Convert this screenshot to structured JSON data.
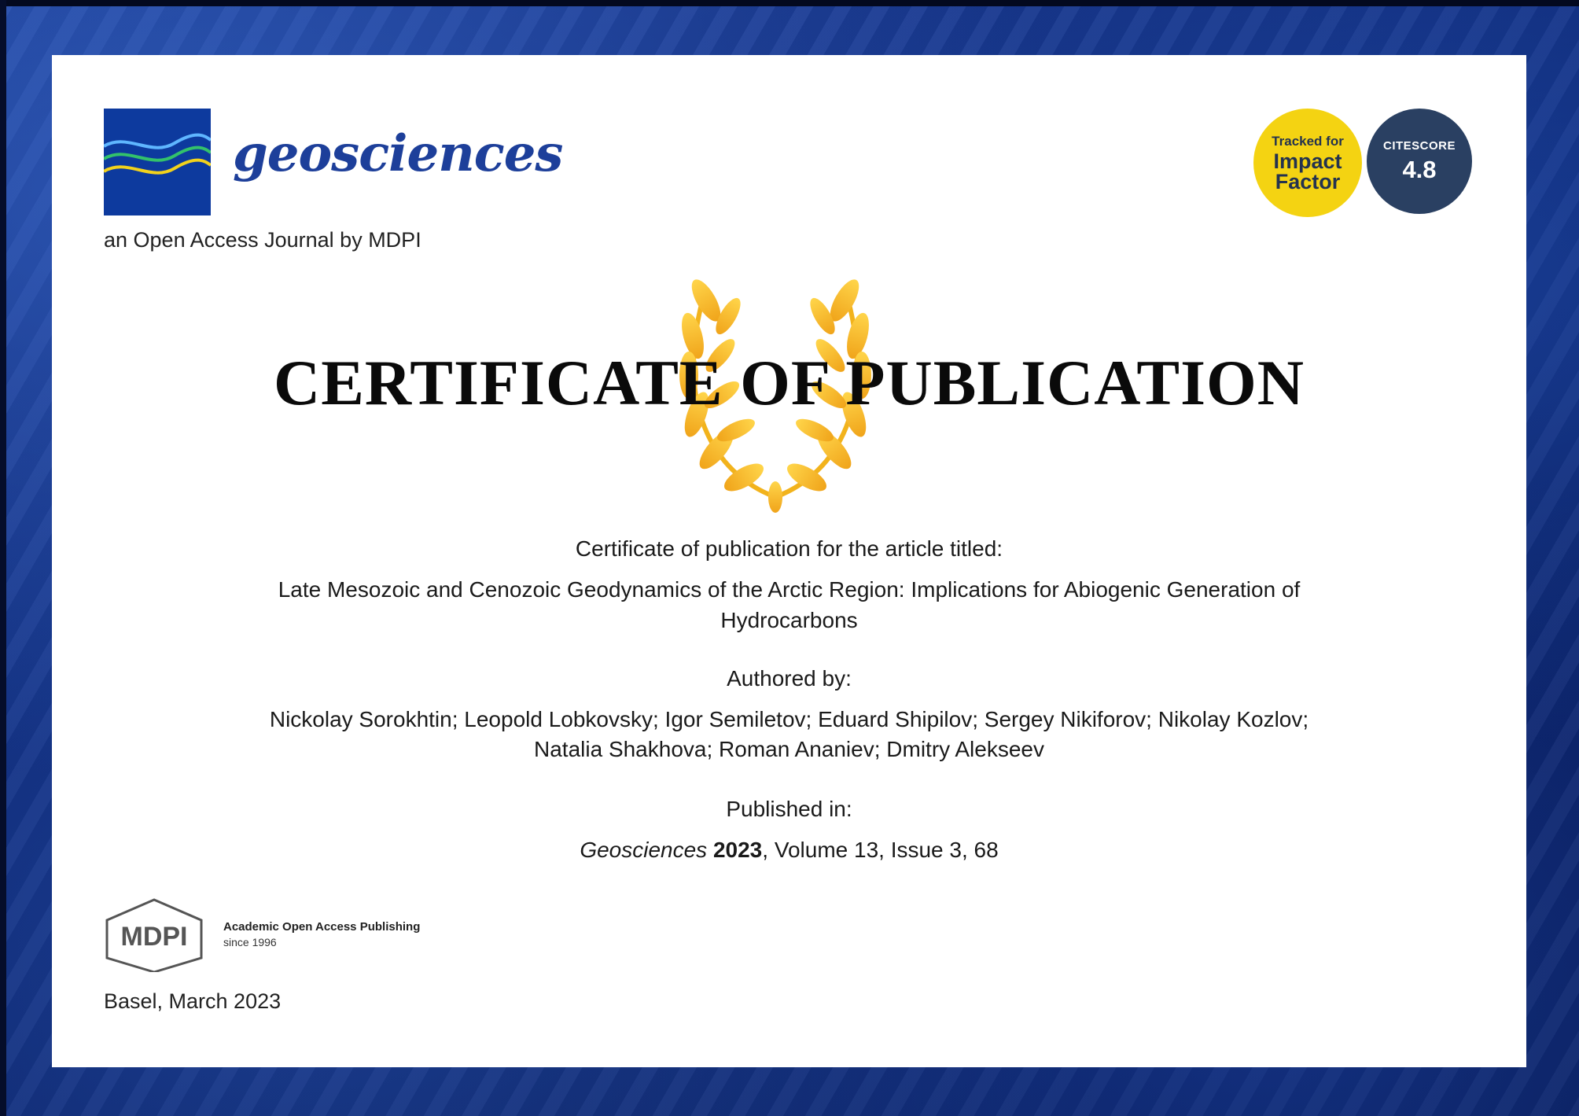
{
  "journal": {
    "name": "geosciences",
    "tagline": "an Open Access Journal by MDPI"
  },
  "badges": {
    "impact_small": "Tracked for",
    "impact_line1": "Impact",
    "impact_line2": "Factor",
    "cite_label": "CITESCORE",
    "cite_value": "4.8"
  },
  "certificate": {
    "title": "CERTIFICATE OF PUBLICATION",
    "intro": "Certificate of publication for the article titled:",
    "article_line1": "Late Mesozoic and Cenozoic Geodynamics of the Arctic Region: Implications for Abiogenic Generation of",
    "article_line2": "Hydrocarbons",
    "authored_label": "Authored by:",
    "authors_line1": "Nickolay Sorokhtin; Leopold Lobkovsky; Igor Semiletov; Eduard Shipilov; Sergey Nikiforov; Nikolay Kozlov;",
    "authors_line2": "Natalia Shakhova; Roman Ananiev; Dmitry Alekseev",
    "published_label": "Published in:",
    "journal_italic": "Geosciences",
    "year": "2023",
    "volume_issue": ", Volume 13, Issue 3, 68"
  },
  "publisher": {
    "logo_text": "MDPI",
    "slogan": "Academic Open Access Publishing",
    "since": "since 1996",
    "place_date": "Basel, March 2023"
  },
  "colors": {
    "journal_blue": "#1d3f9a",
    "impact_yellow": "#f4d312",
    "citescore_navy": "#2a4062",
    "laurel_gold": "#f2b31c"
  }
}
